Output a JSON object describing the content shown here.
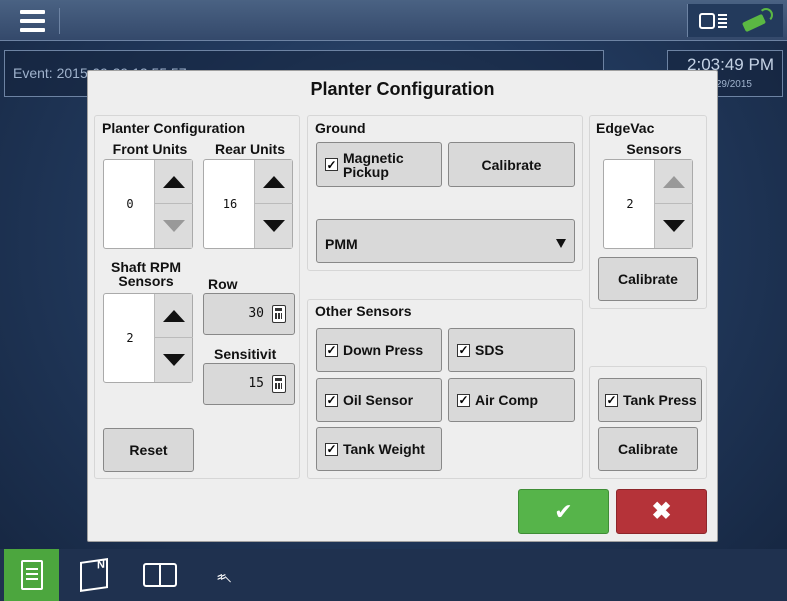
{
  "topbar": {
    "menu_icon": "hamburger-menu-icon",
    "status_icons": [
      "display-icon",
      "gps-satellite-icon"
    ],
    "accent_color": "#5bb843"
  },
  "status": {
    "event_text": "Event: 2015-09-29 12:55:57",
    "time": "2:03:49 PM",
    "date": "29/2015"
  },
  "dialog": {
    "title": "Planter Configuration",
    "planter": {
      "group_label": "Planter Configuration",
      "front_units_label": "Front Units",
      "front_units_value": "0",
      "rear_units_label": "Rear Units",
      "rear_units_value": "16",
      "shaft_rpm_label_1": "Shaft RPM",
      "shaft_rpm_label_2": "Sensors",
      "shaft_rpm_value": "2",
      "row_label": "Row",
      "row_value": "30",
      "sensitivity_label": "Sensitivit",
      "sensitivity_value": "15",
      "reset_label": "Reset"
    },
    "ground": {
      "group_label": "Ground",
      "magnetic_pickup_line1": "Magnetic",
      "magnetic_pickup_line2": "Pickup",
      "magnetic_pickup_checked": true,
      "calibrate_label": "Calibrate",
      "select_value": "PMM"
    },
    "other_sensors": {
      "group_label": "Other Sensors",
      "items": [
        {
          "label": "Down Press",
          "checked": true
        },
        {
          "label": "SDS",
          "checked": true
        },
        {
          "label": "Oil Sensor",
          "checked": true
        },
        {
          "label": "Air Comp",
          "checked": true
        },
        {
          "label": "Tank Weight",
          "checked": true
        }
      ]
    },
    "edgevac": {
      "group_label": "EdgeVac",
      "sensors_label": "Sensors",
      "sensors_value": "2",
      "calibrate_label": "Calibrate"
    },
    "tank_press": {
      "label": "Tank Press",
      "checked": true,
      "calibrate_label": "Calibrate"
    },
    "ok_symbol": "✔",
    "cancel_symbol": "✖",
    "ok_color": "#56b44a",
    "cancel_color": "#b53339"
  },
  "bottombar": {
    "items": [
      "document-icon",
      "field-map-icon",
      "split-view-icon",
      "seed-planter-icon"
    ]
  }
}
